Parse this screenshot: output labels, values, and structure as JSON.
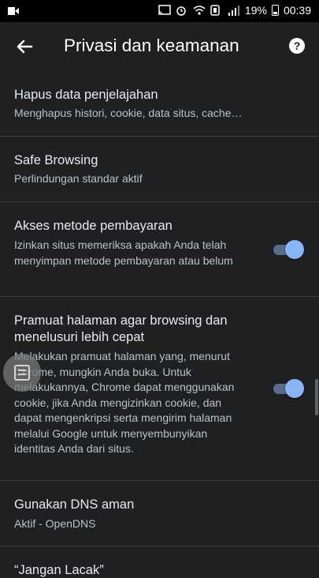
{
  "status": {
    "battery": "19%",
    "time": "00:39"
  },
  "appbar": {
    "title": "Privasi dan keamanan",
    "help_glyph": "?"
  },
  "items": [
    {
      "title": "Hapus data penjelajahan",
      "subtitle": "Menghapus histori, cookie, data situs, cache…"
    },
    {
      "title": "Safe Browsing",
      "subtitle": "Perlindungan standar aktif"
    },
    {
      "title": "Akses metode pembayaran",
      "subtitle": "Izinkan situs memeriksa apakah Anda telah menyimpan metode pembayaran atau belum",
      "toggle_on": true
    },
    {
      "title_line1": "Pramuat halaman agar browsing dan",
      "title_line2": "menelusuri lebih cepat",
      "subtitle": "Melakukan pramuat halaman yang, menurut Chrome, mungkin Anda buka. Untuk melakukannya, Chrome dapat menggunakan cookie, jika Anda mengizinkan cookie, dan dapat mengenkripsi serta mengirim halaman melalui Google untuk menyembunyikan identitas Anda dari situs.",
      "toggle_on": true
    },
    {
      "title": "Gunakan DNS aman",
      "subtitle": "Aktif - OpenDNS"
    },
    {
      "title": "“Jangan Lacak”"
    }
  ]
}
